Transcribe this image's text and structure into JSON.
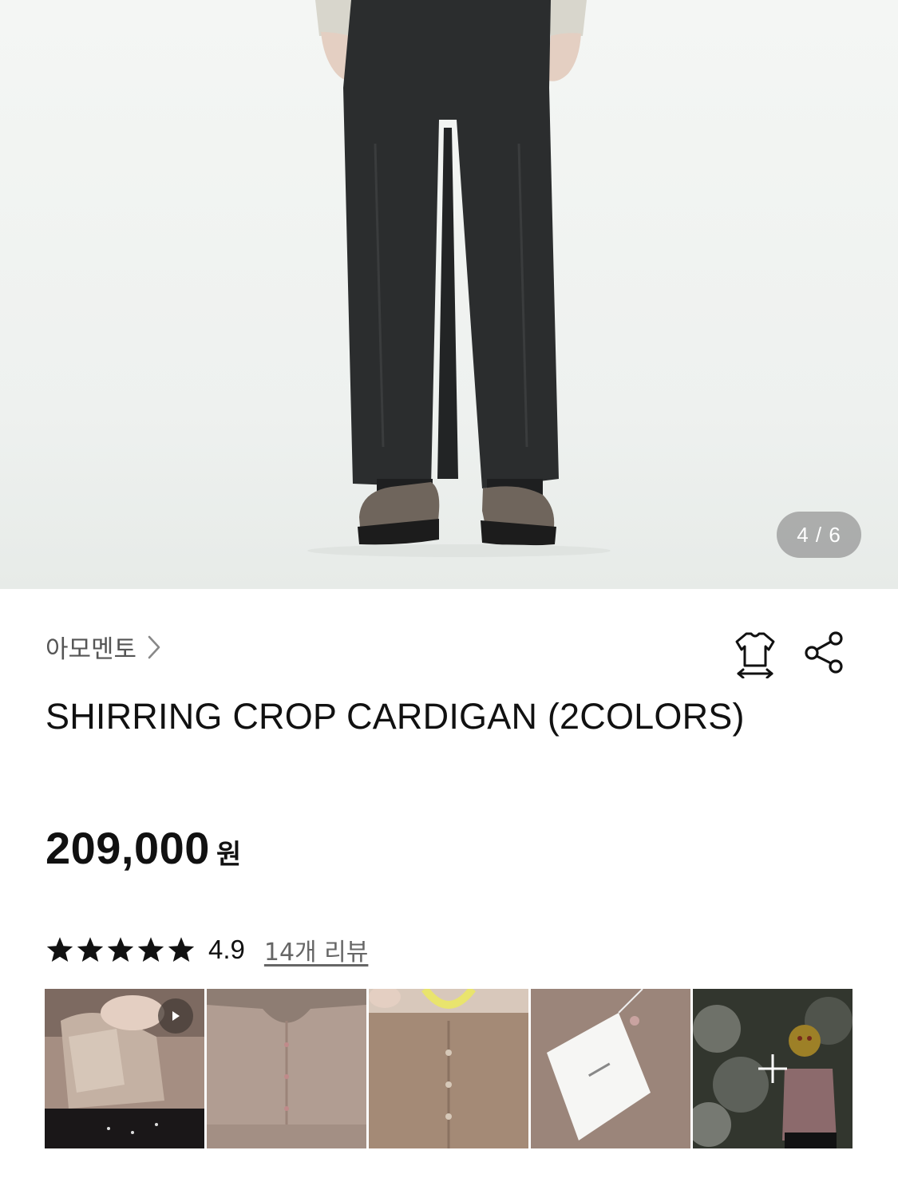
{
  "gallery": {
    "counter": "4 / 6",
    "image_subject": "model-wearing-black-trousers-and-brown-loafers"
  },
  "product": {
    "brand": "아모멘토",
    "title": "SHIRRING CROP CARDIGAN (2COLORS)",
    "price": "209,000",
    "currency": "원"
  },
  "rating": {
    "stars": 5,
    "value": "4.9",
    "reviews_label": "14개 리뷰"
  },
  "review_photos": [
    {
      "kind": "video",
      "subject": "beige-cardigan-on-person"
    },
    {
      "kind": "photo",
      "subject": "cardigan-fabric-closeup"
    },
    {
      "kind": "photo",
      "subject": "cardigan-held-up"
    },
    {
      "kind": "photo",
      "subject": "cardigan-with-tag"
    },
    {
      "kind": "more",
      "subject": "person-in-pink-cardigan"
    }
  ],
  "icons": [
    "chevron-right-icon",
    "size-guide-icon",
    "share-icon",
    "star-icon",
    "play-icon",
    "plus-icon"
  ],
  "colors": {
    "text_primary": "#111111",
    "text_secondary": "#555555",
    "counter_bg": "#8a8a8a",
    "background": "#ffffff"
  }
}
